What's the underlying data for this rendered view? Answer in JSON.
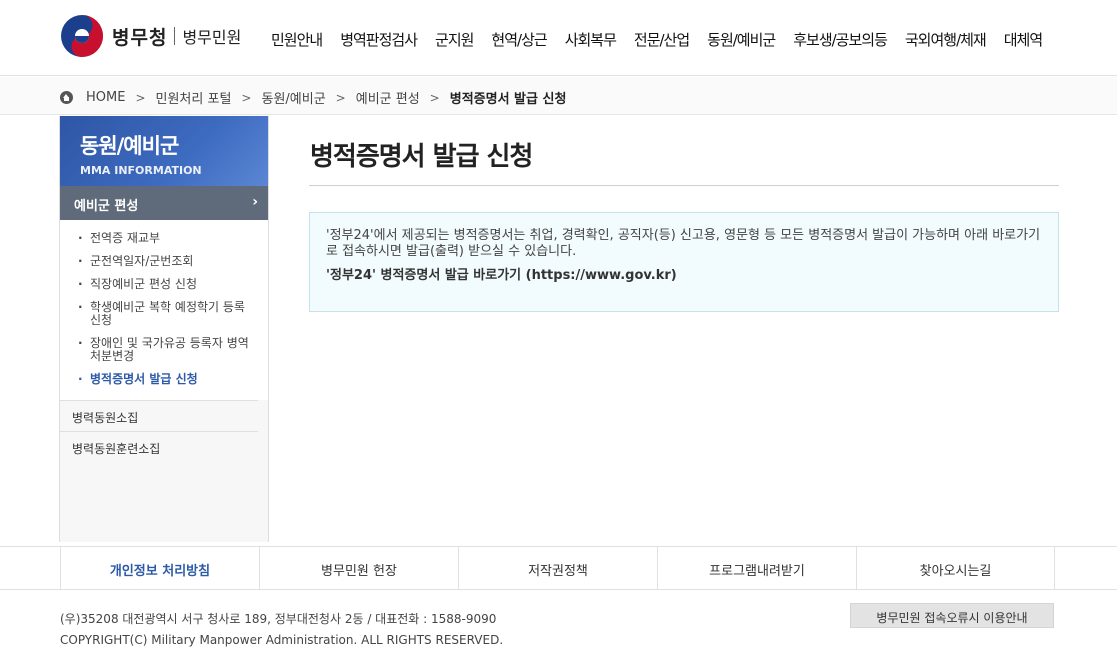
{
  "header": {
    "logo_main": "병무청",
    "logo_sub": "병무민원",
    "nav": [
      "민원안내",
      "병역판정검사",
      "군지원",
      "현역/상근",
      "사회복무",
      "전문/산업",
      "동원/예비군",
      "후보생/공보의등",
      "국외여행/체재",
      "대체역"
    ]
  },
  "breadcrumb": [
    "HOME",
    "민원처리 포털",
    "동원/예비군",
    "예비군 편성",
    "병적증명서 발급 신청"
  ],
  "sidebar": {
    "title": "동원/예비군",
    "subtitle": "MMA INFORMATION",
    "active_group": "예비군 편성",
    "sub_items": [
      "전역증 재교부",
      "군전역일자/군번조회",
      "직장예비군 편성 신청",
      "학생예비군 복학 예정학기 등록 신청",
      "장애인 및 국가유공 등록자 병역처분변경",
      "병적증명서 발급 신청"
    ],
    "other_items": [
      "병력동원소집",
      "병력동원훈련소집"
    ]
  },
  "main": {
    "title": "병적증명서 발급 신청",
    "notice_text": "'정부24'에서 제공되는 병적증명서는 취업, 경력확인, 공직자(등) 신고용, 영문형 등 모든 병적증명서 발급이 가능하며 아래 바로가기로 접속하시면 발급(출력) 받으실 수 있습니다.",
    "notice_link": "'정부24' 병적증명서 발급 바로가기 (https://www.gov.kr)"
  },
  "footer": {
    "nav": [
      "개인정보 처리방침",
      "병무민원 헌장",
      "저작권정책",
      "프로그램내려받기",
      "찾아오시는길"
    ],
    "address": "(우)35208 대전광역시 서구 청사로 189, 정부대전청사 2동 / 대표전화 : 1588-9090",
    "copyright": "COPYRIGHT(C) Military Manpower Administration. ALL RIGHTS RESERVED.",
    "error_guide": "병무민원 접속오류시 이용안내"
  },
  "colors": {
    "brand_blue": "#2d5aa8",
    "active_gray": "#5f6b7a",
    "notice_bg": "#f2fbfd"
  }
}
